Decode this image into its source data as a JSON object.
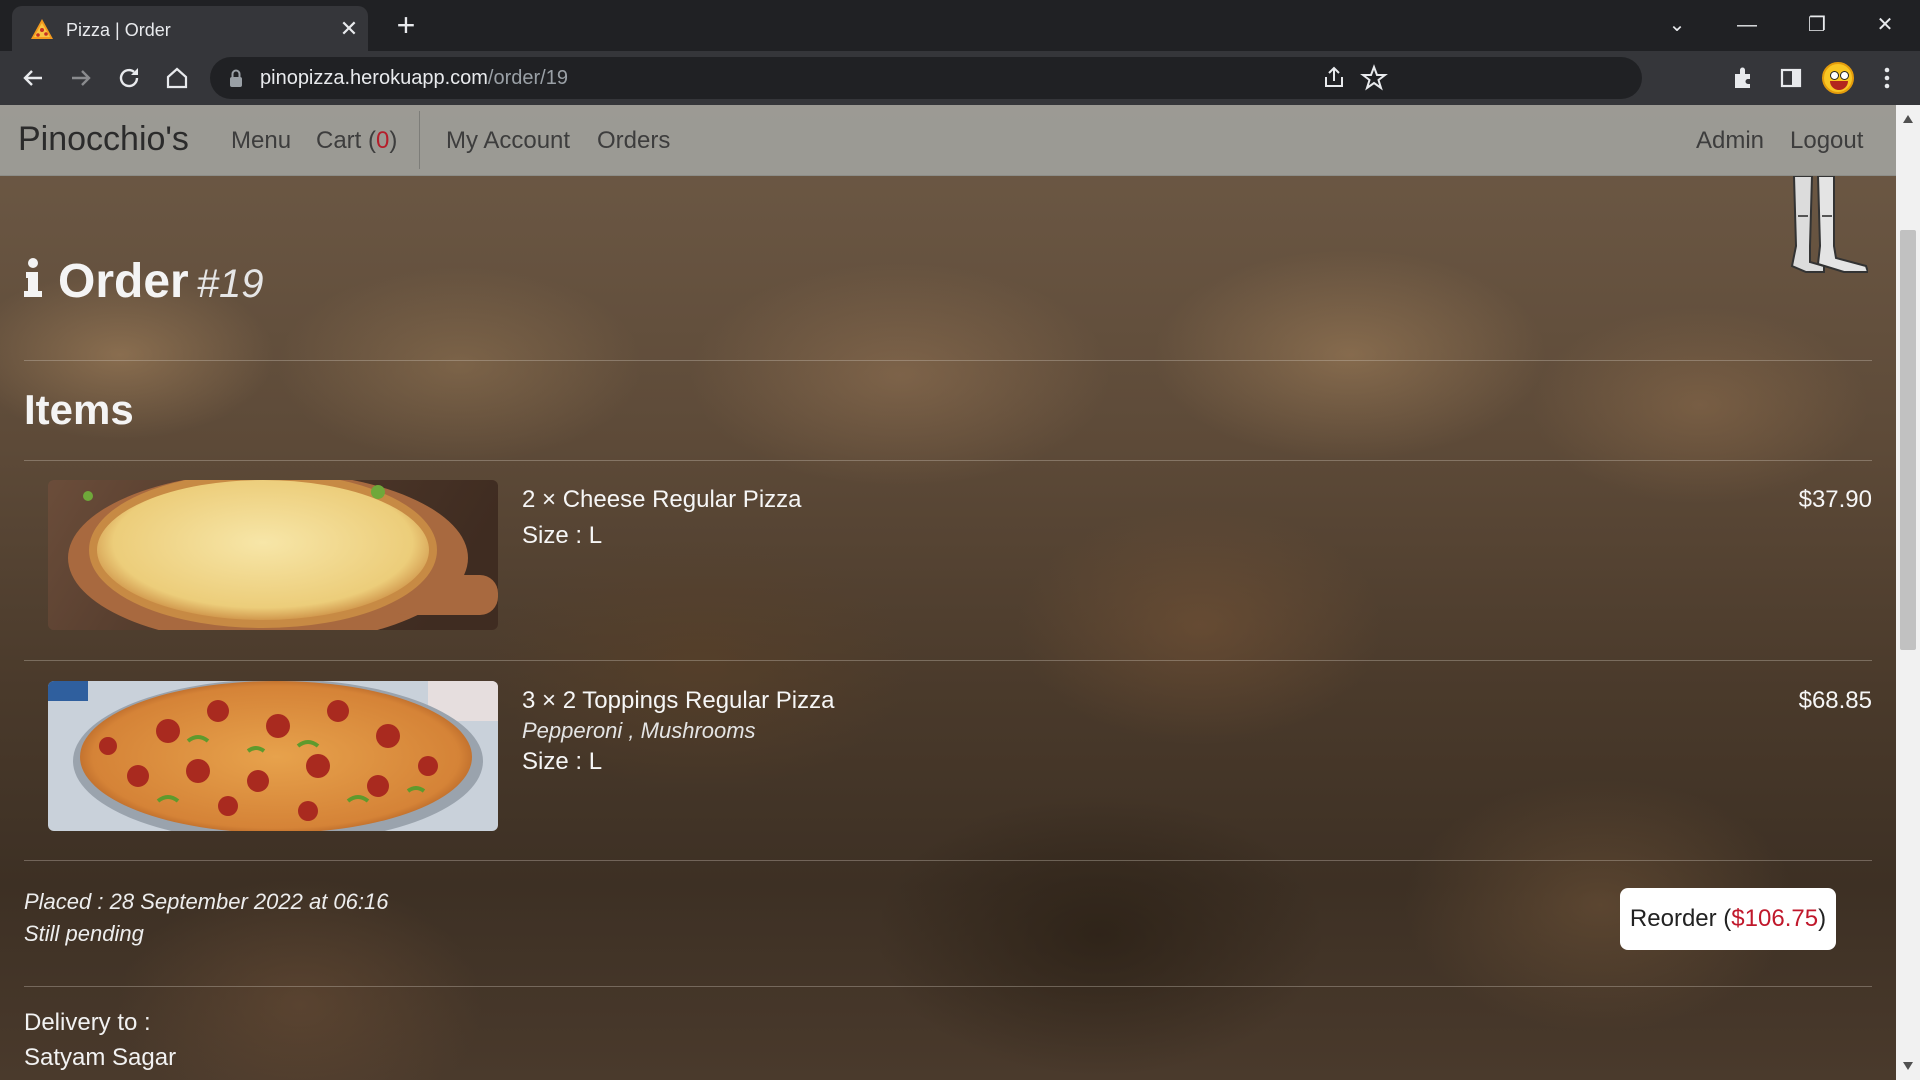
{
  "browser": {
    "tab_title": "Pizza | Order",
    "tab_close": "✕",
    "new_tab": "+",
    "url_host": "pinopizza.herokuapp.com",
    "url_path": "/order/19",
    "window_minimize": "—",
    "window_restore": "❐",
    "window_close": "✕",
    "tab_search": "⌄"
  },
  "nav": {
    "brand": "Pinocchio's",
    "menu": "Menu",
    "cart_label": "Cart (",
    "cart_count": "0",
    "cart_close": ")",
    "my_account": "My Account",
    "orders": "Orders",
    "admin": "Admin",
    "logout": "Logout"
  },
  "order": {
    "title": "Order",
    "number": "#19",
    "items_heading": "Items",
    "items": [
      {
        "name": "2 × Cheese Regular Pizza",
        "size": "Size : L",
        "price": "$37.90"
      },
      {
        "name": "3 × 2 Toppings Regular Pizza",
        "toppings": "Pepperoni , Mushrooms",
        "size": "Size : L",
        "price": "$68.85"
      }
    ],
    "placed": "Placed : 28 September 2022 at 06:16",
    "status": "Still pending",
    "reorder_label": "Reorder (",
    "reorder_amount": "$106.75",
    "reorder_close": ")",
    "delivery_label": "Delivery to :",
    "delivery_name": "Satyam Sagar"
  }
}
